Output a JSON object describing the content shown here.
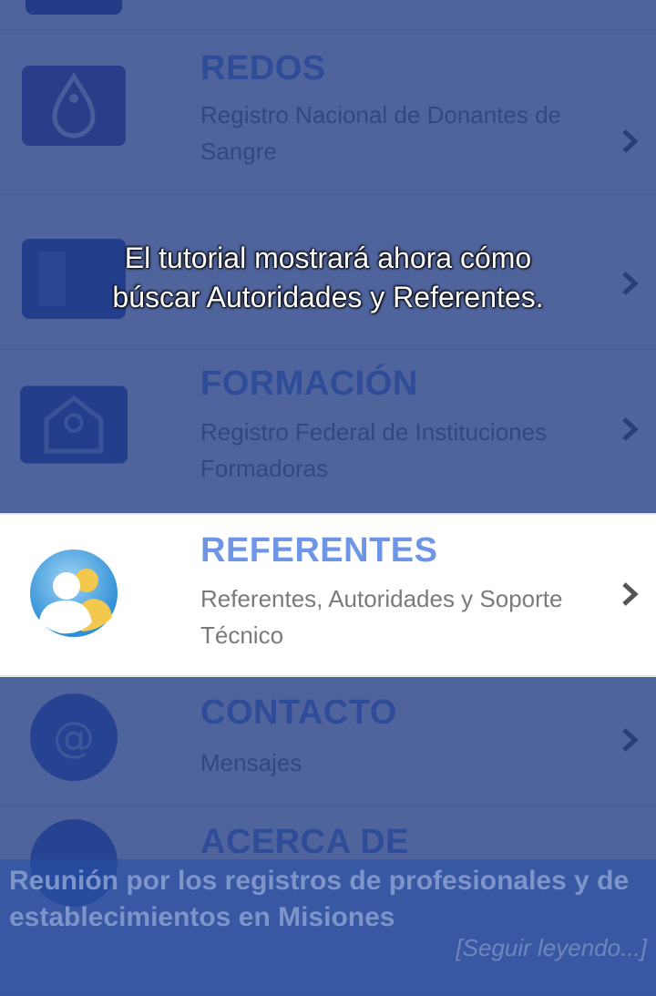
{
  "menu": {
    "items": [
      {
        "title": "",
        "subtitle": "",
        "icon": "document-icon"
      },
      {
        "title": "REDOS",
        "subtitle": "Registro Nacional de Donantes de Sangre",
        "icon": "blood-drop-icon"
      },
      {
        "title": "",
        "subtitle": "",
        "icon": "building-icon"
      },
      {
        "title": "FORMACIÓN",
        "subtitle": "Registro Federal de Instituciones Formadoras",
        "icon": "school-icon"
      },
      {
        "title": "REFERENTES",
        "subtitle": "Referentes, Autoridades y Soporte Técnico",
        "icon": "people-icon"
      },
      {
        "title": "CONTACTO",
        "subtitle": "Mensajes",
        "icon": "at-sign-icon"
      },
      {
        "title": "ACERCA DE",
        "subtitle": "",
        "icon": "info-icon"
      }
    ]
  },
  "tutorial": {
    "line1": "El tutorial mostrará ahora cómo",
    "line2": "búscar Autoridades y Referentes."
  },
  "news": {
    "headline": "Reunión por los registros de profesionales y de establecimientos en Misiones",
    "more_label": "[Seguir leyendo...]"
  },
  "colors": {
    "accent": "#6f95e6",
    "overlay": "#1e3782",
    "chevron": "#555555"
  }
}
